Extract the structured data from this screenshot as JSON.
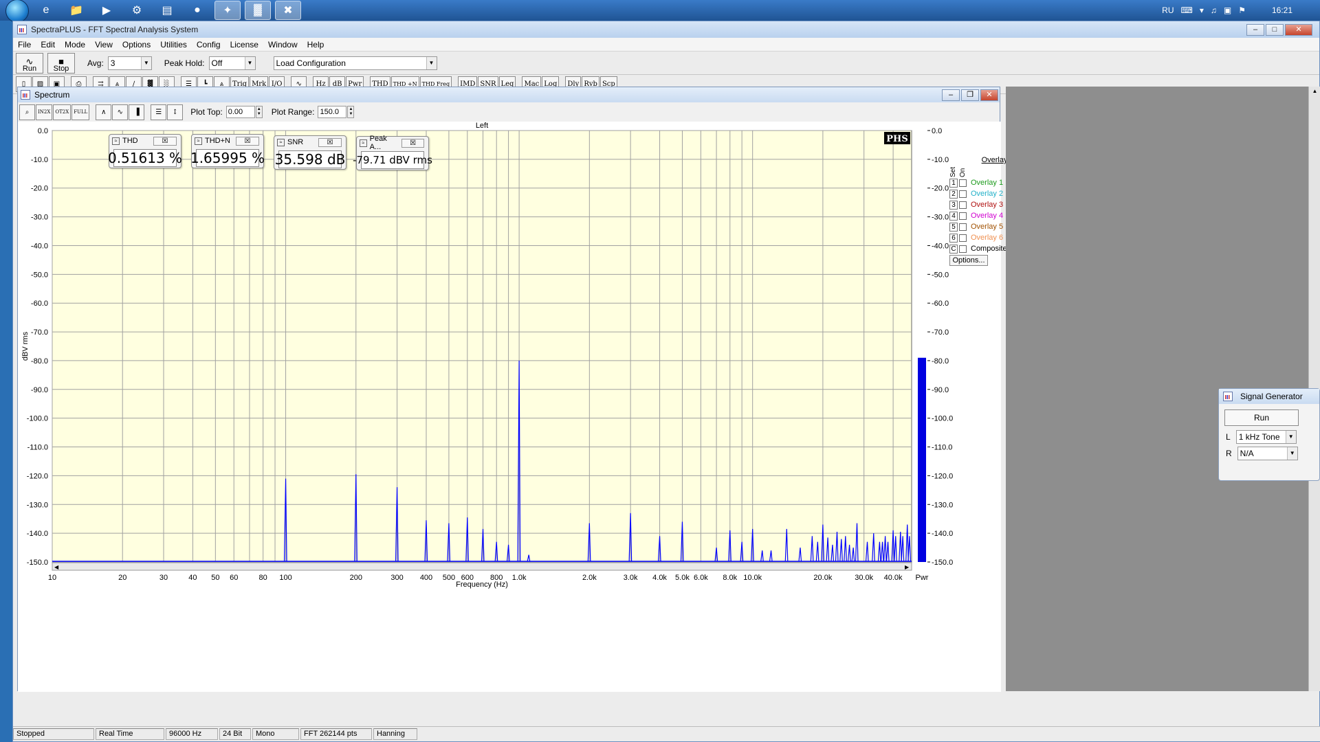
{
  "taskbar": {
    "lang": "RU",
    "clock": "16:21"
  },
  "window": {
    "title": "SpectraPLUS - FFT Spectral Analysis System"
  },
  "menu": [
    "File",
    "Edit",
    "Mode",
    "View",
    "Options",
    "Utilities",
    "Config",
    "License",
    "Window",
    "Help"
  ],
  "toolbar1": {
    "run_label": "Run",
    "stop_label": "Stop",
    "avg_label": "Avg:",
    "avg_value": "3",
    "peak_hold_label": "Peak Hold:",
    "peak_hold_value": "Off",
    "config_value": "Load Configuration"
  },
  "toolbar2": [
    "Trig",
    "Mrk",
    "I/O",
    "Hz",
    "dB",
    "Pwr",
    "THD",
    "THD +N",
    "THD Freq",
    "IMD",
    "SNR",
    "Leq",
    "Mac",
    "Log",
    "Dly",
    "Rvb",
    "Scp"
  ],
  "spectrum": {
    "title": "Spectrum",
    "plot_top_label": "Plot Top:",
    "plot_top_value": "0.00",
    "plot_range_label": "Plot Range:",
    "plot_range_value": "150.0",
    "channel": "Left",
    "logo": "PHS",
    "pwr_label": "Pwr"
  },
  "meters": [
    {
      "name": "THD",
      "value": "0.51613 %"
    },
    {
      "name": "THD+N",
      "value": "1.65995 %"
    },
    {
      "name": "SNR",
      "value": "35.598 dB"
    },
    {
      "name": "Peak A...",
      "value": "-79.71 dBV rms"
    }
  ],
  "overlays": {
    "header": "Overlays",
    "set_label": "Set",
    "on_label": "On",
    "items": [
      {
        "num": "1",
        "label": "Overlay 1",
        "color": "#1a9a1a"
      },
      {
        "num": "2",
        "label": "Overlay 2",
        "color": "#20b0c8"
      },
      {
        "num": "3",
        "label": "Overlay 3",
        "color": "#b01010"
      },
      {
        "num": "4",
        "label": "Overlay 4",
        "color": "#d000d0"
      },
      {
        "num": "5",
        "label": "Overlay 5",
        "color": "#a05000"
      },
      {
        "num": "6",
        "label": "Overlay 6",
        "color": "#f09050"
      },
      {
        "num": "C",
        "label": "Composite",
        "color": "#000000"
      }
    ],
    "options_label": "Options..."
  },
  "siggen": {
    "title": "Signal Generator",
    "run_label": "Run",
    "l_label": "L",
    "l_value": "1 kHz Tone",
    "r_label": "R",
    "r_value": "N/A"
  },
  "status": [
    "Stopped",
    "Real Time",
    "96000 Hz",
    "24 Bit",
    "Mono",
    "FFT 262144 pts",
    "Hanning"
  ],
  "chart_data": {
    "type": "line",
    "title": "",
    "xlabel": "Frequency (Hz)",
    "ylabel": "dBV rms",
    "x_scale": "log",
    "xlim": [
      10,
      48000
    ],
    "ylim": [
      -150,
      0
    ],
    "y_ticks": [
      "0.0",
      "-10.0",
      "-20.0",
      "-30.0",
      "-40.0",
      "-50.0",
      "-60.0",
      "-70.0",
      "-80.0",
      "-90.0",
      "-100.0",
      "-110.0",
      "-120.0",
      "-130.0",
      "-140.0",
      "-150.0"
    ],
    "x_ticks": [
      {
        "v": 10,
        "label": "10"
      },
      {
        "v": 20,
        "label": "20"
      },
      {
        "v": 30,
        "label": "30"
      },
      {
        "v": 40,
        "label": "40"
      },
      {
        "v": 50,
        "label": "50"
      },
      {
        "v": 60,
        "label": "60"
      },
      {
        "v": 80,
        "label": "80"
      },
      {
        "v": 100,
        "label": "100"
      },
      {
        "v": 200,
        "label": "200"
      },
      {
        "v": 300,
        "label": "300"
      },
      {
        "v": 400,
        "label": "400"
      },
      {
        "v": 500,
        "label": "500"
      },
      {
        "v": 600,
        "label": "600"
      },
      {
        "v": 800,
        "label": "800"
      },
      {
        "v": 1000,
        "label": "1.0k"
      },
      {
        "v": 2000,
        "label": "2.0k"
      },
      {
        "v": 3000,
        "label": "3.0k"
      },
      {
        "v": 4000,
        "label": "4.0k"
      },
      {
        "v": 5000,
        "label": "5.0k"
      },
      {
        "v": 6000,
        "label": "6.0k"
      },
      {
        "v": 8000,
        "label": "8.0k"
      },
      {
        "v": 10000,
        "label": "10.0k"
      },
      {
        "v": 20000,
        "label": "20.0k"
      },
      {
        "v": 30000,
        "label": "30.0k"
      },
      {
        "v": 40000,
        "label": "40.0k"
      }
    ],
    "grid": true,
    "series": [
      {
        "color": "#0000ff",
        "peaks": [
          [
            100,
            -121
          ],
          [
            200,
            -119.5
          ],
          [
            300,
            -124
          ],
          [
            400,
            -135.5
          ],
          [
            500,
            -136.5
          ],
          [
            600,
            -134.5
          ],
          [
            700,
            -138.5
          ],
          [
            800,
            -143
          ],
          [
            900,
            -144
          ],
          [
            1000,
            -80
          ],
          [
            1100,
            -147.5
          ],
          [
            2000,
            -136.5
          ],
          [
            3000,
            -133
          ],
          [
            4000,
            -141
          ],
          [
            5000,
            -136
          ],
          [
            7000,
            -145
          ],
          [
            8000,
            -139
          ],
          [
            9000,
            -143
          ],
          [
            10000,
            -138.5
          ],
          [
            11000,
            -146
          ],
          [
            12000,
            -146
          ],
          [
            14000,
            -138.5
          ],
          [
            16000,
            -145
          ],
          [
            18000,
            -141
          ],
          [
            19000,
            -143
          ],
          [
            20000,
            -137
          ],
          [
            21000,
            -141.5
          ],
          [
            22000,
            -144
          ],
          [
            23000,
            -139.5
          ],
          [
            24000,
            -142
          ],
          [
            25000,
            -141
          ],
          [
            26000,
            -144
          ],
          [
            27000,
            -145
          ],
          [
            28000,
            -136.5
          ],
          [
            31000,
            -143
          ],
          [
            33000,
            -140
          ],
          [
            35000,
            -143
          ],
          [
            36000,
            -143
          ],
          [
            37000,
            -141
          ],
          [
            38000,
            -143
          ],
          [
            40000,
            -139
          ],
          [
            41000,
            -141
          ],
          [
            43000,
            -139.5
          ],
          [
            44000,
            -141
          ],
          [
            46000,
            -137
          ],
          [
            47000,
            -141
          ]
        ]
      }
    ],
    "pwr_bar": {
      "top_db": -79,
      "bottom_db": -150,
      "color": "#0000e0"
    },
    "right_ticks": [
      "0.0",
      "-10.0",
      "-20.0",
      "-30.0",
      "-40.0",
      "-50.0",
      "-60.0",
      "-70.0",
      "-80.0",
      "-90.0",
      "-100.0",
      "-110.0",
      "-120.0",
      "-130.0",
      "-140.0",
      "-150.0"
    ]
  }
}
